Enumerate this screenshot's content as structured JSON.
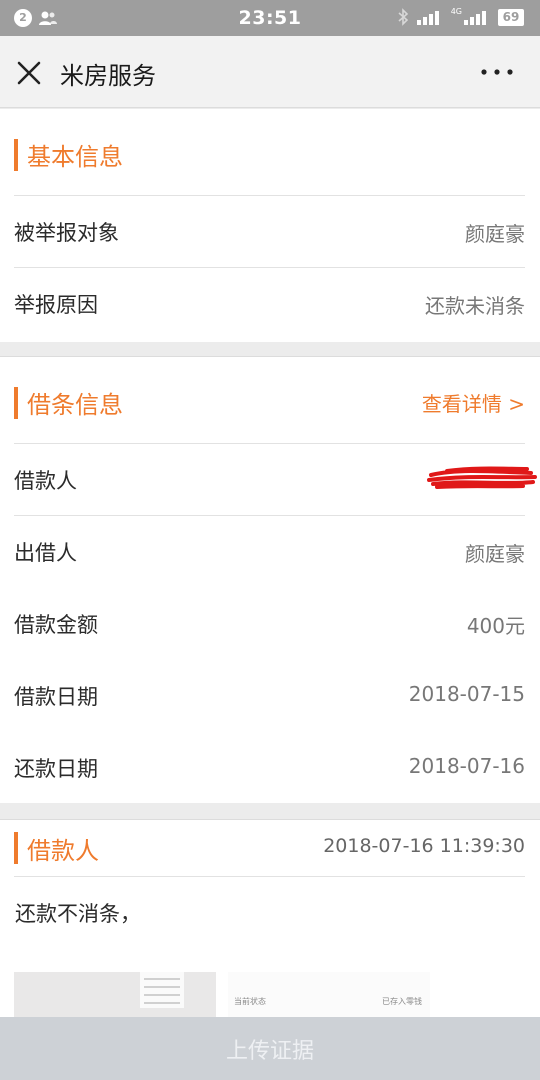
{
  "status_bar": {
    "notification_count": "2",
    "time": "23:51",
    "network_label": "4G",
    "battery": "69"
  },
  "nav": {
    "title": "米房服务",
    "close_icon": "close-icon",
    "more_icon": "more-icon"
  },
  "basic_info": {
    "title": "基本信息",
    "rows": [
      {
        "label": "被举报对象",
        "value": "颜庭豪"
      },
      {
        "label": "举报原因",
        "value": "还款未消条"
      }
    ]
  },
  "loan_info": {
    "title": "借条信息",
    "detail_link": "查看详情 >",
    "rows": [
      {
        "label": "借款人",
        "value": ""
      },
      {
        "label": "出借人",
        "value": "颜庭豪"
      },
      {
        "label": "借款金额",
        "value": "400元"
      },
      {
        "label": "借款日期",
        "value": "2018-07-15"
      },
      {
        "label": "还款日期",
        "value": "2018-07-16"
      }
    ]
  },
  "complaint": {
    "author": "借款人",
    "timestamp": "2018-07-16 11:39:30",
    "text": "还款不消条，",
    "thumb_text": [
      "当前状态",
      "已存入零钱"
    ]
  },
  "upload": {
    "label": "上传证据"
  },
  "colors": {
    "accent": "#ef7b2d",
    "status_bar": "#9e9e9e",
    "upload_disabled": "#cdd1d6",
    "redaction": "#e01818"
  }
}
